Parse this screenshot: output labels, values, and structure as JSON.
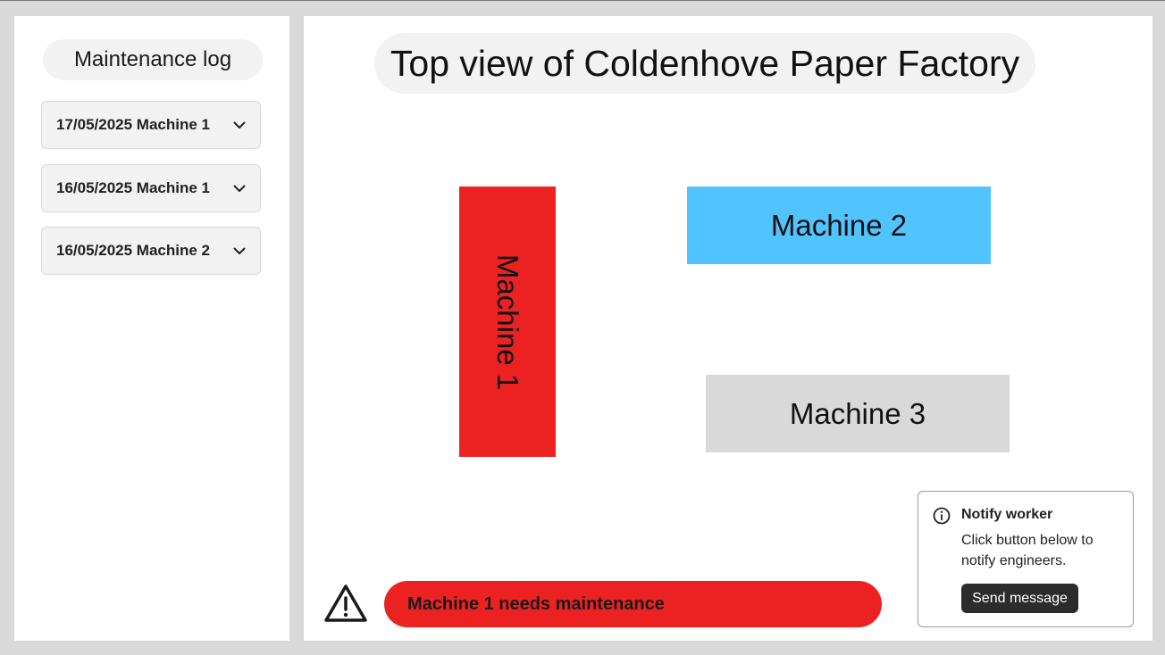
{
  "sidebar": {
    "title": "Maintenance log",
    "items": [
      {
        "label": "17/05/2025 Machine 1",
        "icon": "chevron-down-icon"
      },
      {
        "label": "16/05/2025 Machine 1",
        "icon": "chevron-down-icon"
      },
      {
        "label": "16/05/2025 Machine 2",
        "icon": "chevron-down-icon"
      }
    ]
  },
  "main": {
    "title": "Top view of Coldenhove Paper Factory",
    "machines": [
      {
        "label": "Machine 1",
        "color": "#ec2222",
        "status": "alert"
      },
      {
        "label": "Machine 2",
        "color": "#51c3ff",
        "status": "ok"
      },
      {
        "label": "Machine 3",
        "color": "#d9d9d9",
        "status": "idle"
      }
    ],
    "alert": {
      "icon": "warning-triangle-icon",
      "text": "Machine 1 needs maintenance",
      "color": "#ec2222"
    }
  },
  "notify": {
    "icon": "info-icon",
    "title": "Notify worker",
    "body": "Click button below to notify engineers.",
    "button": "Send message"
  }
}
